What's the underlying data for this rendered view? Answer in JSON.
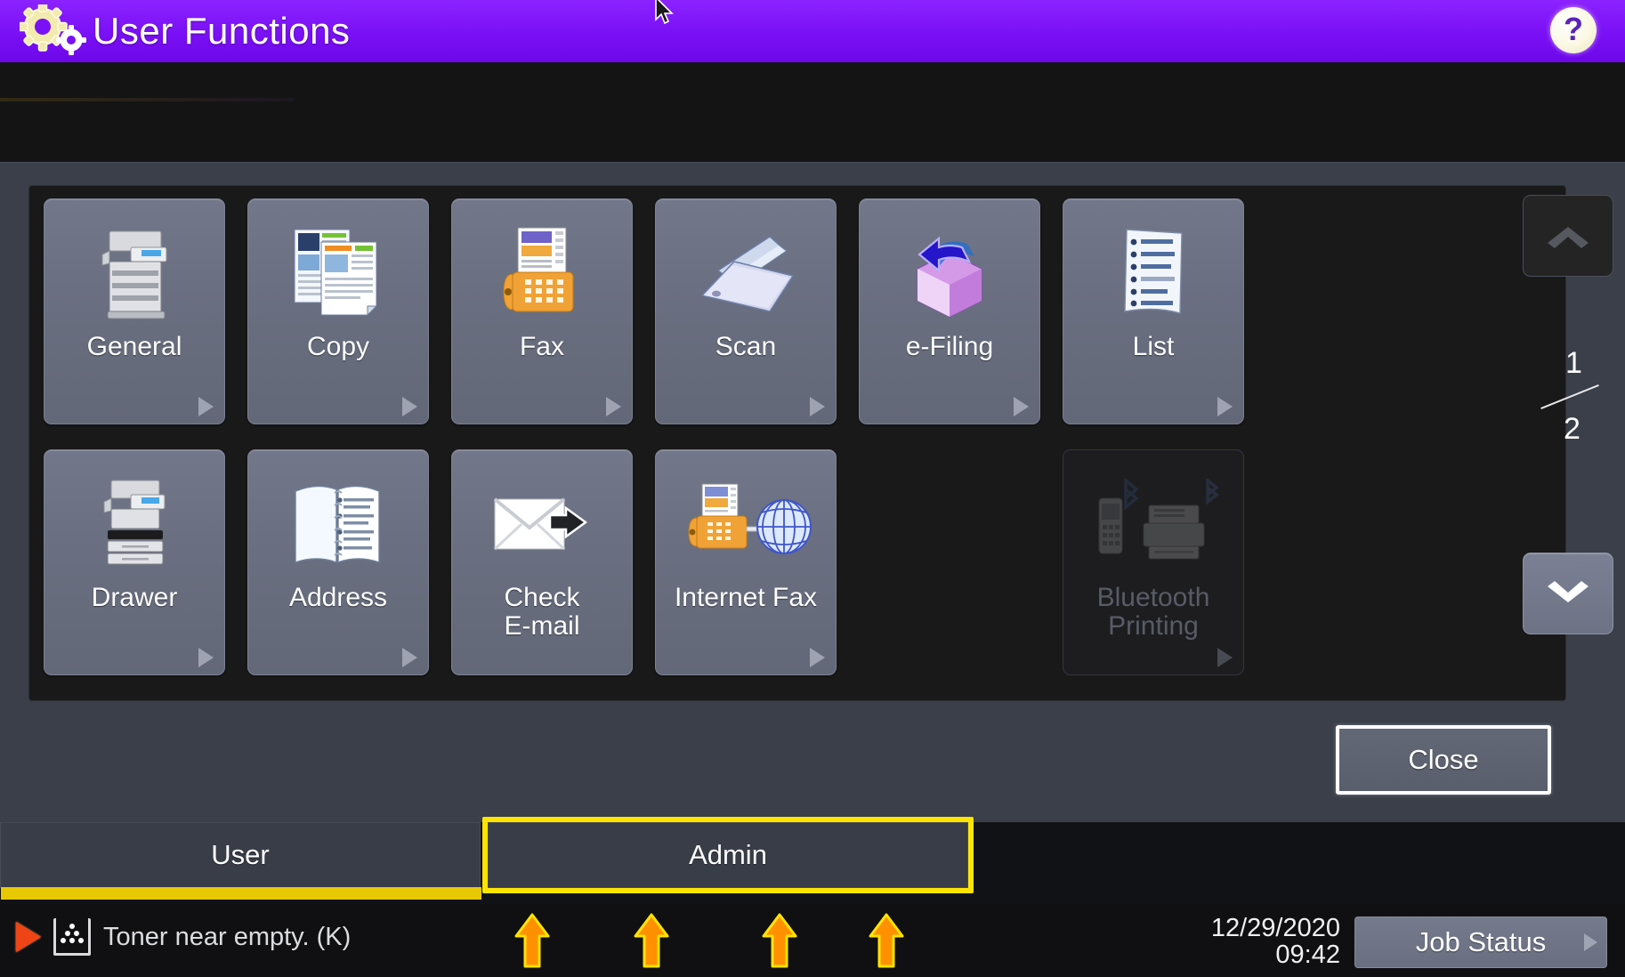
{
  "header": {
    "title": "User Functions",
    "gear_icon": "gears-icon",
    "help_label": "?"
  },
  "panel": {
    "buttons": [
      {
        "label": "General",
        "icon": "mfp-printer-icon",
        "has_arrow": true,
        "disabled": false
      },
      {
        "label": "Copy",
        "icon": "copy-documents-icon",
        "has_arrow": true,
        "disabled": false
      },
      {
        "label": "Fax",
        "icon": "fax-machine-icon",
        "has_arrow": true,
        "disabled": false
      },
      {
        "label": "Scan",
        "icon": "scanner-icon",
        "has_arrow": true,
        "disabled": false
      },
      {
        "label": "e-Filing",
        "icon": "efiling-box-icon",
        "has_arrow": true,
        "disabled": false
      },
      {
        "label": "List",
        "icon": "list-document-icon",
        "has_arrow": true,
        "disabled": false
      },
      {
        "label": "Drawer",
        "icon": "drawer-printer-icon",
        "has_arrow": true,
        "disabled": false
      },
      {
        "label": "Address",
        "icon": "address-book-icon",
        "has_arrow": true,
        "disabled": false
      },
      {
        "label": "Check\nE-mail",
        "icon": "envelope-check-icon",
        "has_arrow": false,
        "disabled": false
      },
      {
        "label": "Internet Fax",
        "icon": "internet-fax-icon",
        "has_arrow": true,
        "disabled": false
      },
      {
        "label": "Bluetooth\nPrinting",
        "icon": "bluetooth-print-icon",
        "has_arrow": true,
        "disabled": true
      }
    ]
  },
  "pager": {
    "up_icon": "chevron-up-icon",
    "down_icon": "chevron-down-icon",
    "current_page": "1",
    "total_pages": "2",
    "up_enabled": false,
    "down_enabled": true
  },
  "actions": {
    "close_label": "Close"
  },
  "tabs": [
    {
      "label": "User",
      "active": true,
      "highlighted": false
    },
    {
      "label": "Admin",
      "active": false,
      "highlighted": true
    }
  ],
  "status": {
    "alert_icon": "play-triangle-icon",
    "toner_icon": "toner-icon",
    "message": "Toner near empty. (K)",
    "date": "12/29/2020",
    "time": "09:42",
    "job_status_label": "Job Status"
  },
  "annotations": {
    "arrow_icon": "up-arrow-annotation",
    "arrow_x_positions": [
      598,
      732,
      876,
      996
    ],
    "arrow_color": "#ff9100",
    "arrow_outline": "#ffe400"
  },
  "colors": {
    "header_purple": "#7a10f5",
    "panel_gray": "#3a3f4a",
    "button_gray": "#6a6f81",
    "tab_highlight_yellow": "#ffe400",
    "tab_active_underline": "#e8c800",
    "alert_red": "#ef4415"
  },
  "cursor": {
    "icon": "mouse-pointer-icon"
  }
}
